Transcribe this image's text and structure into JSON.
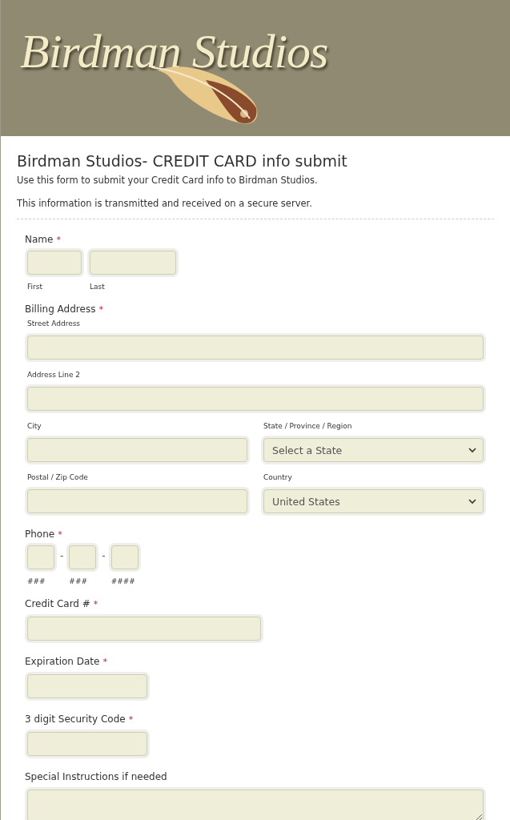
{
  "header": {
    "logo_text": "Birdman Studios"
  },
  "form": {
    "title": "Birdman Studios- CREDIT CARD info submit",
    "description": [
      "Use this form to submit your Credit Card info to Birdman Studios.",
      "This information is transmitted and received on a secure server."
    ],
    "required_mark": "*",
    "fields": [
      {
        "kind": "multi",
        "label": "Name",
        "required": true,
        "parts": [
          {
            "kind": "small",
            "sublabel": "First"
          },
          {
            "kind": "medium",
            "sublabel": "Last"
          }
        ]
      },
      {
        "kind": "address",
        "label": "Billing Address",
        "required": true,
        "rows": [
          [
            {
              "kind": "text",
              "sublabel": "Street Address"
            }
          ],
          [
            {
              "kind": "text",
              "sublabel": "Address Line 2"
            }
          ],
          [
            {
              "kind": "text",
              "sublabel": "City"
            },
            {
              "kind": "select",
              "sublabel": "State / Province / Region",
              "value": "Select a State"
            }
          ],
          [
            {
              "kind": "text",
              "sublabel": "Postal / Zip Code"
            },
            {
              "kind": "select",
              "sublabel": "Country",
              "value": "United States"
            }
          ]
        ]
      },
      {
        "kind": "multi",
        "label": "Phone",
        "required": true,
        "separator": "-",
        "parts": [
          {
            "kind": "tiny",
            "sublabel": "###"
          },
          {
            "kind": "tiny",
            "sublabel": "###"
          },
          {
            "kind": "tiny",
            "sublabel": "####"
          }
        ]
      },
      {
        "kind": "long",
        "label": "Credit Card #",
        "required": true
      },
      {
        "kind": "short",
        "label": "Expiration Date",
        "required": true
      },
      {
        "kind": "short",
        "label": "3 digit Security Code",
        "required": true
      },
      {
        "kind": "textarea",
        "label": "Special Instructions if needed",
        "required": false
      }
    ]
  }
}
